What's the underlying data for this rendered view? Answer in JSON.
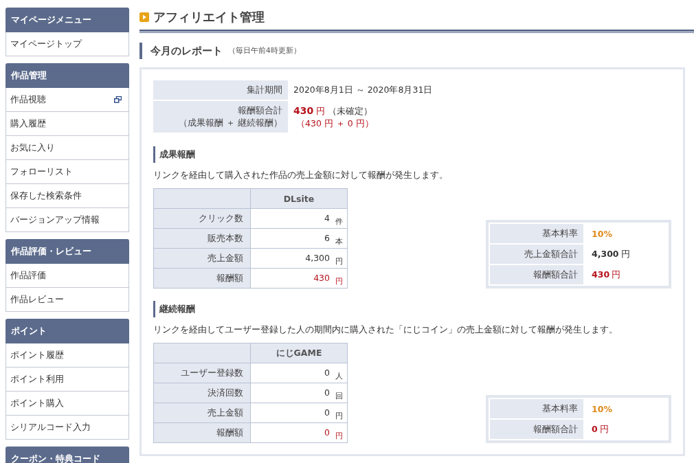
{
  "sidebar": [
    {
      "title": "マイページメニュー",
      "items": [
        {
          "label": "マイページトップ",
          "external": false
        }
      ]
    },
    {
      "title": "作品管理",
      "items": [
        {
          "label": "作品視聴",
          "external": true
        },
        {
          "label": "購入履歴",
          "external": false
        },
        {
          "label": "お気に入り",
          "external": false
        },
        {
          "label": "フォローリスト",
          "external": false
        },
        {
          "label": "保存した検索条件",
          "external": false
        },
        {
          "label": "バージョンアップ情報",
          "external": false
        }
      ]
    },
    {
      "title": "作品評価・レビュー",
      "items": [
        {
          "label": "作品評価",
          "external": false
        },
        {
          "label": "作品レビュー",
          "external": false
        }
      ]
    },
    {
      "title": "ポイント",
      "items": [
        {
          "label": "ポイント履歴",
          "external": false
        },
        {
          "label": "ポイント利用",
          "external": false
        },
        {
          "label": "ポイント購入",
          "external": false
        },
        {
          "label": "シリアルコード入力",
          "external": false
        }
      ]
    },
    {
      "title": "クーポン・特典コード"
    }
  ],
  "page_title": "アフィリエイト管理",
  "report": {
    "title": "今月のレポート",
    "note": "（毎日午前4時更新）",
    "period": {
      "label": "集計期間",
      "value": "2020年8月1日 ～ 2020年8月31日"
    },
    "total": {
      "label": "報酬額合計",
      "sublabel": "（成果報酬 ＋ 継続報酬）",
      "amount": "430",
      "unit": "円",
      "status": "（未確定）",
      "breakdown": "（430 円 ＋ 0 円）"
    },
    "sections": [
      {
        "title": "成果報酬",
        "description": "リンクを経由して購入された作品の売上金額に対して報酬が発生します。",
        "column": "DLsite",
        "rows": [
          {
            "label": "クリック数",
            "value": "4",
            "unit": "件",
            "kind": "plain"
          },
          {
            "label": "販売本数",
            "value": "6",
            "unit": "本",
            "kind": "plain"
          },
          {
            "label": "売上金額",
            "value": "4,300",
            "unit": "円",
            "kind": "plain"
          },
          {
            "label": "報酬額",
            "value": "430",
            "unit": "円",
            "kind": "reward"
          }
        ],
        "totals": [
          {
            "label": "基本料率",
            "value": "10%",
            "kind": "rate"
          },
          {
            "label": "売上金額合計",
            "value": "4,300",
            "unit": "円",
            "kind": "plain"
          },
          {
            "label": "報酬額合計",
            "value": "430",
            "unit": "円",
            "kind": "reward"
          }
        ]
      },
      {
        "title": "継続報酬",
        "description": "リンクを経由してユーザー登録した人の期間内に購入された「にじコイン」の売上金額に対して報酬が発生します。",
        "column": "にじGAME",
        "rows": [
          {
            "label": "ユーザー登録数",
            "value": "0",
            "unit": "人",
            "kind": "plain"
          },
          {
            "label": "決済回数",
            "value": "0",
            "unit": "回",
            "kind": "plain"
          },
          {
            "label": "売上金額",
            "value": "0",
            "unit": "円",
            "kind": "plain"
          },
          {
            "label": "報酬額",
            "value": "0",
            "unit": "円",
            "kind": "reward"
          }
        ],
        "totals": [
          {
            "label": "基本料率",
            "value": "10%",
            "kind": "rate"
          },
          {
            "label": "報酬額合計",
            "value": "0",
            "unit": "円",
            "kind": "reward"
          }
        ]
      }
    ]
  }
}
